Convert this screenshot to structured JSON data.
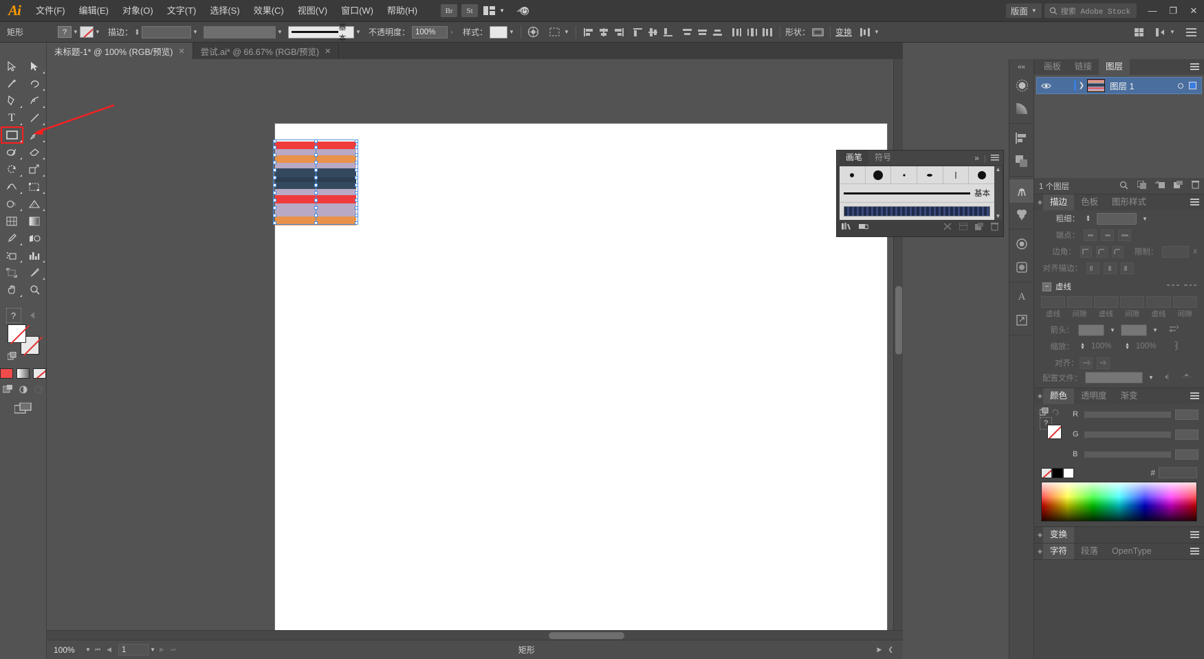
{
  "app": {
    "name": "Ai",
    "title": "Adobe Illustrator"
  },
  "menubar": {
    "items": [
      "文件(F)",
      "编辑(E)",
      "对象(O)",
      "文字(T)",
      "选择(S)",
      "效果(C)",
      "视图(V)",
      "窗口(W)",
      "帮助(H)"
    ],
    "bridge_label": "Br",
    "stock_label": "St",
    "arrange_label": "",
    "layout_label": "版面",
    "search_placeholder": "搜索 Adobe Stock",
    "window_minimize": "—",
    "window_maximize": "❐",
    "window_close": "✕"
  },
  "controlbar": {
    "shape_label": "矩形",
    "fill_value": "?",
    "stroke_label": "描边：",
    "stroke_weight": "",
    "stroke_profile": "",
    "brush_label": "基本",
    "opacity_label": "不透明度：",
    "opacity_value": "100%",
    "style_label": "样式：",
    "shape_prop_label": "形状：",
    "transform_label": "变换",
    "align_label": ""
  },
  "tabs": [
    {
      "label": "未标题-1* @ 100% (RGB/预览)",
      "active": true,
      "close": "✕"
    },
    {
      "label": "尝试.ai* @ 66.67% (RGB/预览)",
      "active": false,
      "close": "✕"
    }
  ],
  "toolbar": {
    "tools": [
      {
        "name": "selection-tool",
        "glyph": "▷",
        "flyout": false
      },
      {
        "name": "direct-selection-tool",
        "glyph": "▶",
        "flyout": true
      },
      {
        "name": "magic-wand-tool",
        "glyph": "✨",
        "flyout": false
      },
      {
        "name": "lasso-tool",
        "glyph": "◠",
        "flyout": true
      },
      {
        "name": "pen-tool",
        "glyph": "✒",
        "flyout": true
      },
      {
        "name": "curvature-tool",
        "glyph": "✐",
        "flyout": true
      },
      {
        "name": "type-tool",
        "glyph": "T",
        "flyout": true
      },
      {
        "name": "line-segment-tool",
        "glyph": "／",
        "flyout": true
      },
      {
        "name": "rectangle-tool",
        "glyph": "▭",
        "flyout": true,
        "selected": true
      },
      {
        "name": "paintbrush-tool",
        "glyph": "🖌",
        "flyout": true
      },
      {
        "name": "shaper-tool",
        "glyph": "◌",
        "flyout": true
      },
      {
        "name": "eraser-tool",
        "glyph": "◇",
        "flyout": true
      },
      {
        "name": "rotate-tool",
        "glyph": "↻",
        "flyout": true
      },
      {
        "name": "scale-tool",
        "glyph": "⤢",
        "flyout": true
      },
      {
        "name": "width-tool",
        "glyph": "⌁",
        "flyout": true
      },
      {
        "name": "free-transform-tool",
        "glyph": "⬚",
        "flyout": true
      },
      {
        "name": "shape-builder-tool",
        "glyph": "⬭",
        "flyout": true
      },
      {
        "name": "perspective-grid-tool",
        "glyph": "⊿",
        "flyout": true
      },
      {
        "name": "mesh-tool",
        "glyph": "▦",
        "flyout": false
      },
      {
        "name": "gradient-tool",
        "glyph": "▩",
        "flyout": false
      },
      {
        "name": "eyedropper-tool",
        "glyph": "⚲",
        "flyout": true
      },
      {
        "name": "blend-tool",
        "glyph": "◑",
        "flyout": false
      },
      {
        "name": "symbol-sprayer-tool",
        "glyph": "⁂",
        "flyout": true
      },
      {
        "name": "column-graph-tool",
        "glyph": "▥",
        "flyout": true
      },
      {
        "name": "artboard-tool",
        "glyph": "⌐",
        "flyout": false
      },
      {
        "name": "slice-tool",
        "glyph": "✂",
        "flyout": true
      },
      {
        "name": "hand-tool",
        "glyph": "✋",
        "flyout": true
      },
      {
        "name": "zoom-tool",
        "glyph": "🔍",
        "flyout": false
      }
    ],
    "fill_color": "#ffffff",
    "stroke_color": "none",
    "swatch_fill": "#f04b4b",
    "help_glyph": "?"
  },
  "canvas": {
    "artwork_stripes": [
      {
        "color": "#ef3b3b",
        "height": 11
      },
      {
        "color": "#b9a9c4",
        "height": 9
      },
      {
        "color": "#e8924b",
        "height": 11
      },
      {
        "color": "#b9a9c4",
        "height": 8
      },
      {
        "color": "#34495e",
        "height": 13
      },
      {
        "color": "#2c3e50",
        "height": 7
      },
      {
        "color": "#34495e",
        "height": 10
      },
      {
        "color": "#b9a9c4",
        "height": 9
      },
      {
        "color": "#ef3b3b",
        "height": 12
      },
      {
        "color": "#b9a9c4",
        "height": 10
      },
      {
        "color": "#b9a9c4",
        "height": 9
      },
      {
        "color": "#e8924b",
        "height": 13
      }
    ],
    "selection_color": "#4a90e2"
  },
  "brushes_panel": {
    "tabs": [
      {
        "label": "画笔",
        "active": true
      },
      {
        "label": "符号",
        "active": false
      }
    ],
    "collapse_glyph": "»",
    "basic_brush_label": "基本",
    "footer_icons": [
      "brush-libraries-icon",
      "libraries-icon",
      "remove-brush-link-icon",
      "options-icon",
      "new-brush-icon",
      "delete-brush-icon"
    ]
  },
  "icon_dock": {
    "icons": [
      "color-guide-icon",
      "gradient-icon",
      "align-icon",
      "pathfinder-icon",
      "symbols-icon",
      "brushes-icon",
      "appearance-icon",
      "graphic-styles-icon",
      "character-icon",
      "artboards-icon"
    ],
    "collapse_glyph": "««"
  },
  "layers_panel": {
    "tabs": [
      {
        "label": "画板",
        "active": false
      },
      {
        "label": "链接",
        "active": false
      },
      {
        "label": "图层",
        "active": true
      }
    ],
    "rows": [
      {
        "name": "图层 1",
        "visible": true,
        "locked": false,
        "selected": true
      }
    ],
    "footer_count": "1 个图层",
    "footer_icons": [
      "locate-object-icon",
      "make-clipping-mask-icon",
      "create-new-sublayer-icon",
      "create-new-layer-icon",
      "delete-selection-icon"
    ]
  },
  "stroke_panel": {
    "tabs": [
      {
        "label": "描边",
        "active": true
      },
      {
        "label": "色板",
        "active": false
      },
      {
        "label": "图形样式",
        "active": false
      }
    ],
    "weight_label": "粗细：",
    "weight_value": "",
    "cap_label": "端点：",
    "corner_label": "边角：",
    "limit_label": "限制：",
    "limit_value": "x",
    "align_stroke_label": "对齐描边：",
    "dashed_label": "虚线",
    "dash_fields": [
      {
        "label": "虚线"
      },
      {
        "label": "间隙"
      },
      {
        "label": "虚线"
      },
      {
        "label": "间隙"
      },
      {
        "label": "虚线"
      },
      {
        "label": "间隙"
      }
    ],
    "arrow_label": "箭头：",
    "scale_label": "缩放：",
    "scale_value_1": "100%",
    "scale_value_2": "100%",
    "align_label": "对齐：",
    "profile_label": "配置文件：",
    "profile_value": ""
  },
  "color_panel": {
    "tabs": [
      {
        "label": "颜色",
        "active": true
      },
      {
        "label": "透明度",
        "active": false
      },
      {
        "label": "渐变",
        "active": false
      }
    ],
    "channels": [
      {
        "label": "R",
        "value": ""
      },
      {
        "label": "G",
        "value": ""
      },
      {
        "label": "B",
        "value": ""
      }
    ],
    "hex_label": "#",
    "hex_value": ""
  },
  "transform_panel": {
    "label": "变换"
  },
  "character_panel": {
    "tabs": [
      {
        "label": "字符",
        "active": true
      },
      {
        "label": "段落",
        "active": false
      },
      {
        "label": "OpenType",
        "active": false
      }
    ]
  },
  "statusbar": {
    "zoom": "100%",
    "page": "1",
    "tool_name": "矩形"
  },
  "annotation": {
    "highlight_color": "#ff1e1e",
    "arrow_target": "rectangle-tool"
  }
}
